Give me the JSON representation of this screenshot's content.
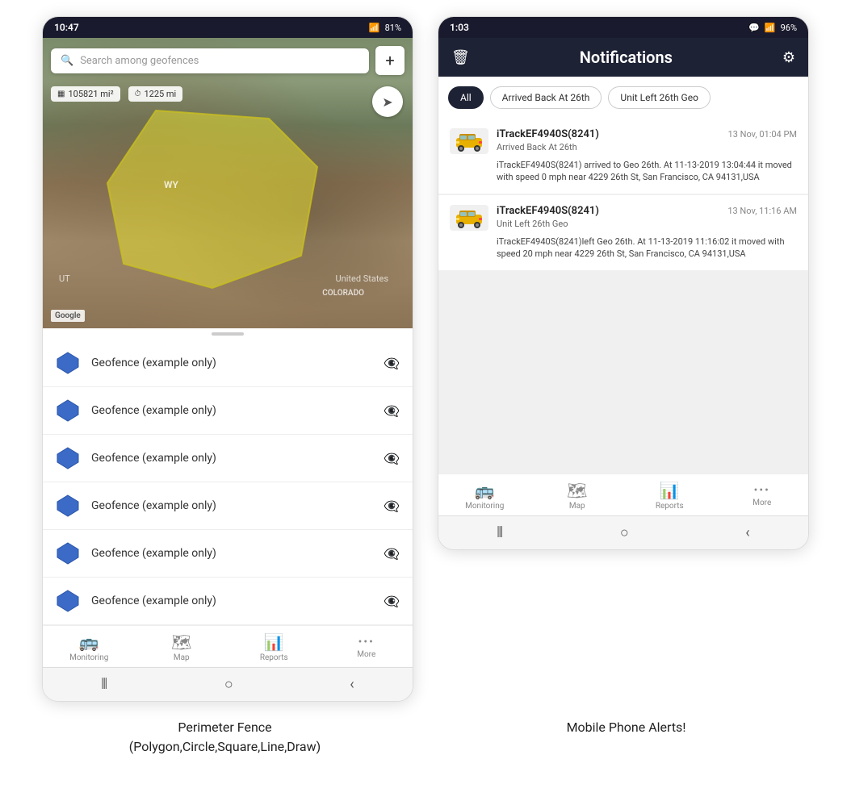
{
  "left_phone": {
    "status_bar": {
      "time": "10:47",
      "signal": "WiFi",
      "network": "4G",
      "battery": "81%"
    },
    "search": {
      "placeholder": "Search among geofences"
    },
    "map_stats": {
      "area": "105821 mi²",
      "distance": "1225 mi"
    },
    "map_labels": {
      "wy": "WY",
      "us": "United States",
      "colorado": "COLORADO",
      "ut": "UT"
    },
    "geofence_items": [
      {
        "label": "Geofence (example only)"
      },
      {
        "label": "Geofence (example only)"
      },
      {
        "label": "Geofence (example only)"
      },
      {
        "label": "Geofence (example only)"
      },
      {
        "label": "Geofence (example only)"
      },
      {
        "label": "Geofence (example only)"
      }
    ],
    "bottom_nav": [
      {
        "label": "Monitoring",
        "icon": "🚌"
      },
      {
        "label": "Map",
        "icon": "🗺"
      },
      {
        "label": "Reports",
        "icon": "📊"
      },
      {
        "label": "More",
        "icon": "···"
      }
    ]
  },
  "right_phone": {
    "status_bar": {
      "time": "1:03",
      "chat_icon": "💬",
      "signal": "WiFi",
      "network": "4G",
      "battery": "96%"
    },
    "header": {
      "title": "Notifications",
      "trash_icon": "🗑",
      "gear_icon": "⚙"
    },
    "filter_tabs": [
      {
        "label": "All",
        "active": true
      },
      {
        "label": "Arrived Back At 26th",
        "active": false
      },
      {
        "label": "Unit Left 26th Geo",
        "active": false
      }
    ],
    "notifications": [
      {
        "device": "iTrackEF4940S(8241)",
        "time": "13 Nov, 01:04 PM",
        "event_type": "Arrived Back At 26th",
        "body": "iTrackEF4940S(8241) arrived to Geo 26th.   At 11-13-2019 13:04:44 it moved with speed 0 mph near 4229 26th St, San Francisco, CA 94131,USA"
      },
      {
        "device": "iTrackEF4940S(8241)",
        "time": "13 Nov, 11:16 AM",
        "event_type": "Unit Left 26th Geo",
        "body": "iTrackEF4940S(8241)left Geo 26th.   At 11-13-2019 11:16:02 it moved with speed 20 mph near 4229 26th St, San Francisco, CA 94131,USA"
      }
    ],
    "bottom_nav": [
      {
        "label": "Monitoring",
        "icon": "🚌"
      },
      {
        "label": "Map",
        "icon": "🗺"
      },
      {
        "label": "Reports",
        "icon": "📊"
      },
      {
        "label": "More",
        "icon": "···"
      }
    ]
  },
  "captions": {
    "left": "Perimeter Fence\n(Polygon,Circle,Square,Line,Draw)",
    "right": "Mobile Phone Alerts!"
  }
}
